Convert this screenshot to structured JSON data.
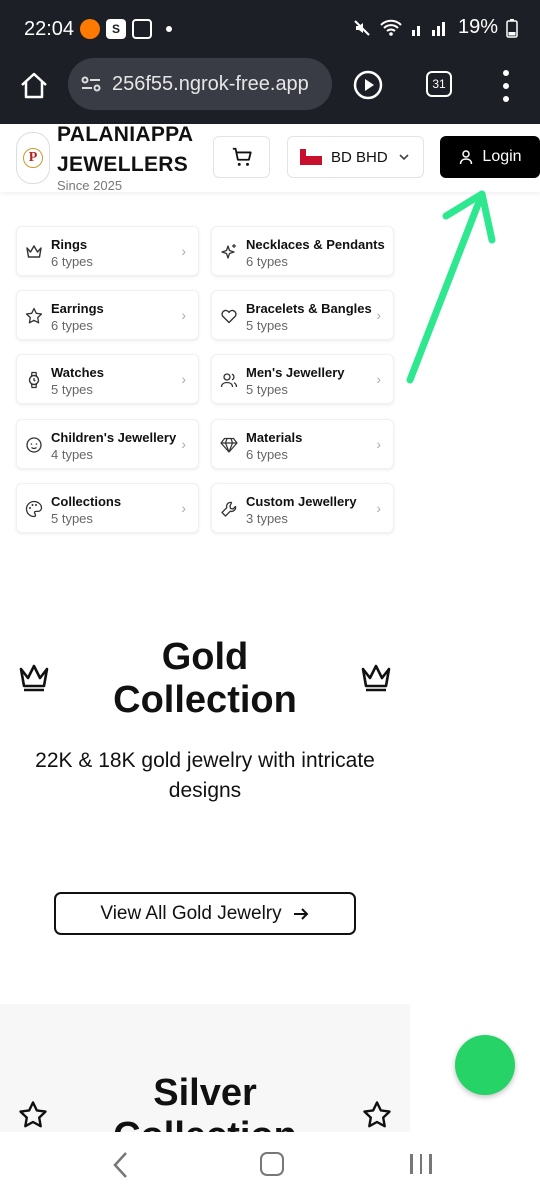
{
  "status_bar": {
    "time": "22:04",
    "battery": "19%"
  },
  "browser": {
    "url": "256f55.ngrok-free.app",
    "tab_count": "31"
  },
  "header": {
    "brand_line1": "PALANIAPPA",
    "brand_line2": "JEWELLERS",
    "since": "Since 2025",
    "currency": "BD BHD",
    "login_label": "Login",
    "logo_letter": "P"
  },
  "categories": [
    {
      "name": "Rings",
      "count": "6 types",
      "icon": "crown-icon"
    },
    {
      "name": "Necklaces & Pendants",
      "count": "6 types",
      "icon": "sparkles-icon"
    },
    {
      "name": "Earrings",
      "count": "6 types",
      "icon": "star-icon"
    },
    {
      "name": "Bracelets & Bangles",
      "count": "5 types",
      "icon": "heart-icon"
    },
    {
      "name": "Watches",
      "count": "5 types",
      "icon": "watch-icon"
    },
    {
      "name": "Men's Jewellery",
      "count": "5 types",
      "icon": "users-icon"
    },
    {
      "name": "Children's Jewellery",
      "count": "4 types",
      "icon": "baby-icon"
    },
    {
      "name": "Materials",
      "count": "6 types",
      "icon": "gem-icon"
    },
    {
      "name": "Collections",
      "count": "5 types",
      "icon": "palette-icon"
    },
    {
      "name": "Custom Jewellery",
      "count": "3 types",
      "icon": "wrench-icon"
    }
  ],
  "gold": {
    "title_line1": "Gold",
    "title_line2": "Collection",
    "description": "22K & 18K gold jewelry with intricate designs",
    "button_label": "View All Gold Jewelry"
  },
  "silver": {
    "title_line1": "Silver",
    "title_line2": "Collection"
  },
  "colors": {
    "browser_bg": "#1c1f26",
    "accent": "#000000",
    "annotation_arrow": "#2ee88f",
    "fab": "#25d366"
  }
}
